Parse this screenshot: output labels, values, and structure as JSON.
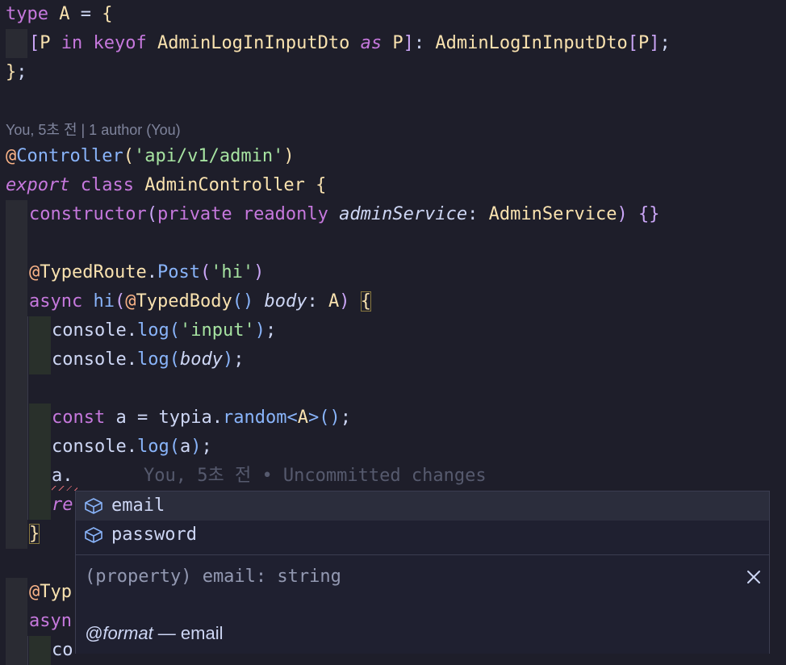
{
  "editor": {
    "lines": [
      {
        "tokens": [
          [
            "kw",
            "type "
          ],
          [
            "ty",
            "A"
          ],
          [
            "tx",
            " = "
          ],
          [
            "br1",
            "{"
          ]
        ]
      },
      {
        "guide": 1,
        "tokens": [
          [
            "br2",
            "["
          ],
          [
            "ty",
            "P"
          ],
          [
            "kw",
            " in "
          ],
          [
            "kw",
            "keyof "
          ],
          [
            "ty",
            "AdminLogInInputDto"
          ],
          [
            "kwi",
            " as "
          ],
          [
            "ty",
            "P"
          ],
          [
            "br2",
            "]"
          ],
          [
            "tx",
            ": "
          ],
          [
            "ty",
            "AdminLogInInputDto"
          ],
          [
            "br2",
            "["
          ],
          [
            "ty",
            "P"
          ],
          [
            "br2",
            "]"
          ],
          [
            "tx",
            ";"
          ]
        ]
      },
      {
        "tokens": [
          [
            "br1",
            "}"
          ],
          [
            "tx",
            ";"
          ]
        ]
      },
      {
        "tokens": []
      },
      {
        "tokens": []
      },
      {
        "tokens": [
          [
            "dec",
            "@"
          ],
          [
            "fn",
            "Controller"
          ],
          [
            "br1",
            "("
          ],
          [
            "str",
            "'api/v1/admin'"
          ],
          [
            "br1",
            ")"
          ]
        ]
      },
      {
        "tokens": [
          [
            "kwi",
            "export"
          ],
          [
            "kw",
            " class "
          ],
          [
            "ty",
            "AdminController"
          ],
          [
            "tx",
            " "
          ],
          [
            "br1",
            "{"
          ]
        ]
      },
      {
        "guide": 1,
        "tokens": [
          [
            "kw",
            "constructor"
          ],
          [
            "br2",
            "("
          ],
          [
            "kw",
            "private "
          ],
          [
            "kw",
            "readonly "
          ],
          [
            "par",
            "adminService"
          ],
          [
            "tx",
            ": "
          ],
          [
            "ty",
            "AdminService"
          ],
          [
            "br2",
            ")"
          ],
          [
            "tx",
            " "
          ],
          [
            "br2",
            "{}"
          ]
        ]
      },
      {
        "guide": 1,
        "tokens": []
      },
      {
        "guide": 1,
        "tokens": [
          [
            "dec",
            "@"
          ],
          [
            "ty",
            "TypedRoute"
          ],
          [
            "tx",
            "."
          ],
          [
            "fn",
            "Post"
          ],
          [
            "br2",
            "("
          ],
          [
            "str",
            "'hi'"
          ],
          [
            "br2",
            ")"
          ]
        ]
      },
      {
        "guide": 1,
        "tokens": [
          [
            "kw",
            "async "
          ],
          [
            "fn",
            "hi"
          ],
          [
            "br2",
            "("
          ],
          [
            "dec",
            "@"
          ],
          [
            "ty",
            "TypedBody"
          ],
          [
            "br3",
            "()"
          ],
          [
            "tx",
            " "
          ],
          [
            "par",
            "body"
          ],
          [
            "tx",
            ": "
          ],
          [
            "ty",
            "A"
          ],
          [
            "br2",
            ")"
          ],
          [
            "tx",
            " "
          ],
          [
            "br2b",
            "{"
          ]
        ]
      },
      {
        "guide": 2,
        "tokens": [
          [
            "tx",
            "console"
          ],
          [
            "tx",
            "."
          ],
          [
            "fn",
            "log"
          ],
          [
            "br3",
            "("
          ],
          [
            "str",
            "'input'"
          ],
          [
            "br3",
            ")"
          ],
          [
            "tx",
            ";"
          ]
        ]
      },
      {
        "guide": 2,
        "tokens": [
          [
            "tx",
            "console"
          ],
          [
            "tx",
            "."
          ],
          [
            "fn",
            "log"
          ],
          [
            "br3",
            "("
          ],
          [
            "par",
            "body"
          ],
          [
            "br3",
            ")"
          ],
          [
            "tx",
            ";"
          ]
        ]
      },
      {
        "guide": 3,
        "tokens": []
      },
      {
        "guide": 2,
        "tokens": [
          [
            "kw",
            "const "
          ],
          [
            "tx",
            "a"
          ],
          [
            "tx",
            " = "
          ],
          [
            "tx",
            "typia"
          ],
          [
            "tx",
            "."
          ],
          [
            "fn",
            "random"
          ],
          [
            "br3",
            "<"
          ],
          [
            "ty",
            "A"
          ],
          [
            "br3",
            ">"
          ],
          [
            "br3",
            "()"
          ],
          [
            "tx",
            ";"
          ]
        ]
      },
      {
        "guide": 2,
        "tokens": [
          [
            "tx",
            "console"
          ],
          [
            "tx",
            "."
          ],
          [
            "fn",
            "log"
          ],
          [
            "br3",
            "("
          ],
          [
            "tx",
            "a"
          ],
          [
            "br3",
            ")"
          ],
          [
            "tx",
            ";"
          ]
        ]
      },
      {
        "guide": 2,
        "tokens": [
          [
            "tx",
            "a."
          ]
        ],
        "blame": true,
        "squiggle": true
      },
      {
        "guide": 2,
        "tokens": [
          [
            "kwi",
            "re"
          ]
        ]
      },
      {
        "guide": 1,
        "tokens": [
          [
            "br2b",
            "}"
          ]
        ]
      },
      {
        "tokens": []
      },
      {
        "guide": 1,
        "tokens": [
          [
            "dec",
            "@"
          ],
          [
            "ty",
            "Typ"
          ]
        ]
      },
      {
        "guide": 1,
        "tokens": [
          [
            "kw",
            "asyn"
          ]
        ]
      },
      {
        "guide": 2,
        "tokens": [
          [
            "tx",
            "co"
          ]
        ]
      }
    ],
    "codelens": "You, 5초 전 | 1 author (You)",
    "inline_blame": "You, 5초 전 • Uncommitted changes"
  },
  "suggest": {
    "items": [
      {
        "label": "email",
        "icon": "property-cube-icon",
        "active": true
      },
      {
        "label": "password",
        "icon": "property-cube-icon",
        "active": false
      }
    ],
    "detail_signature": "(property) email: string",
    "doc_tag": "@format",
    "doc_text": " — email",
    "accent_color": "#89b4fa"
  }
}
